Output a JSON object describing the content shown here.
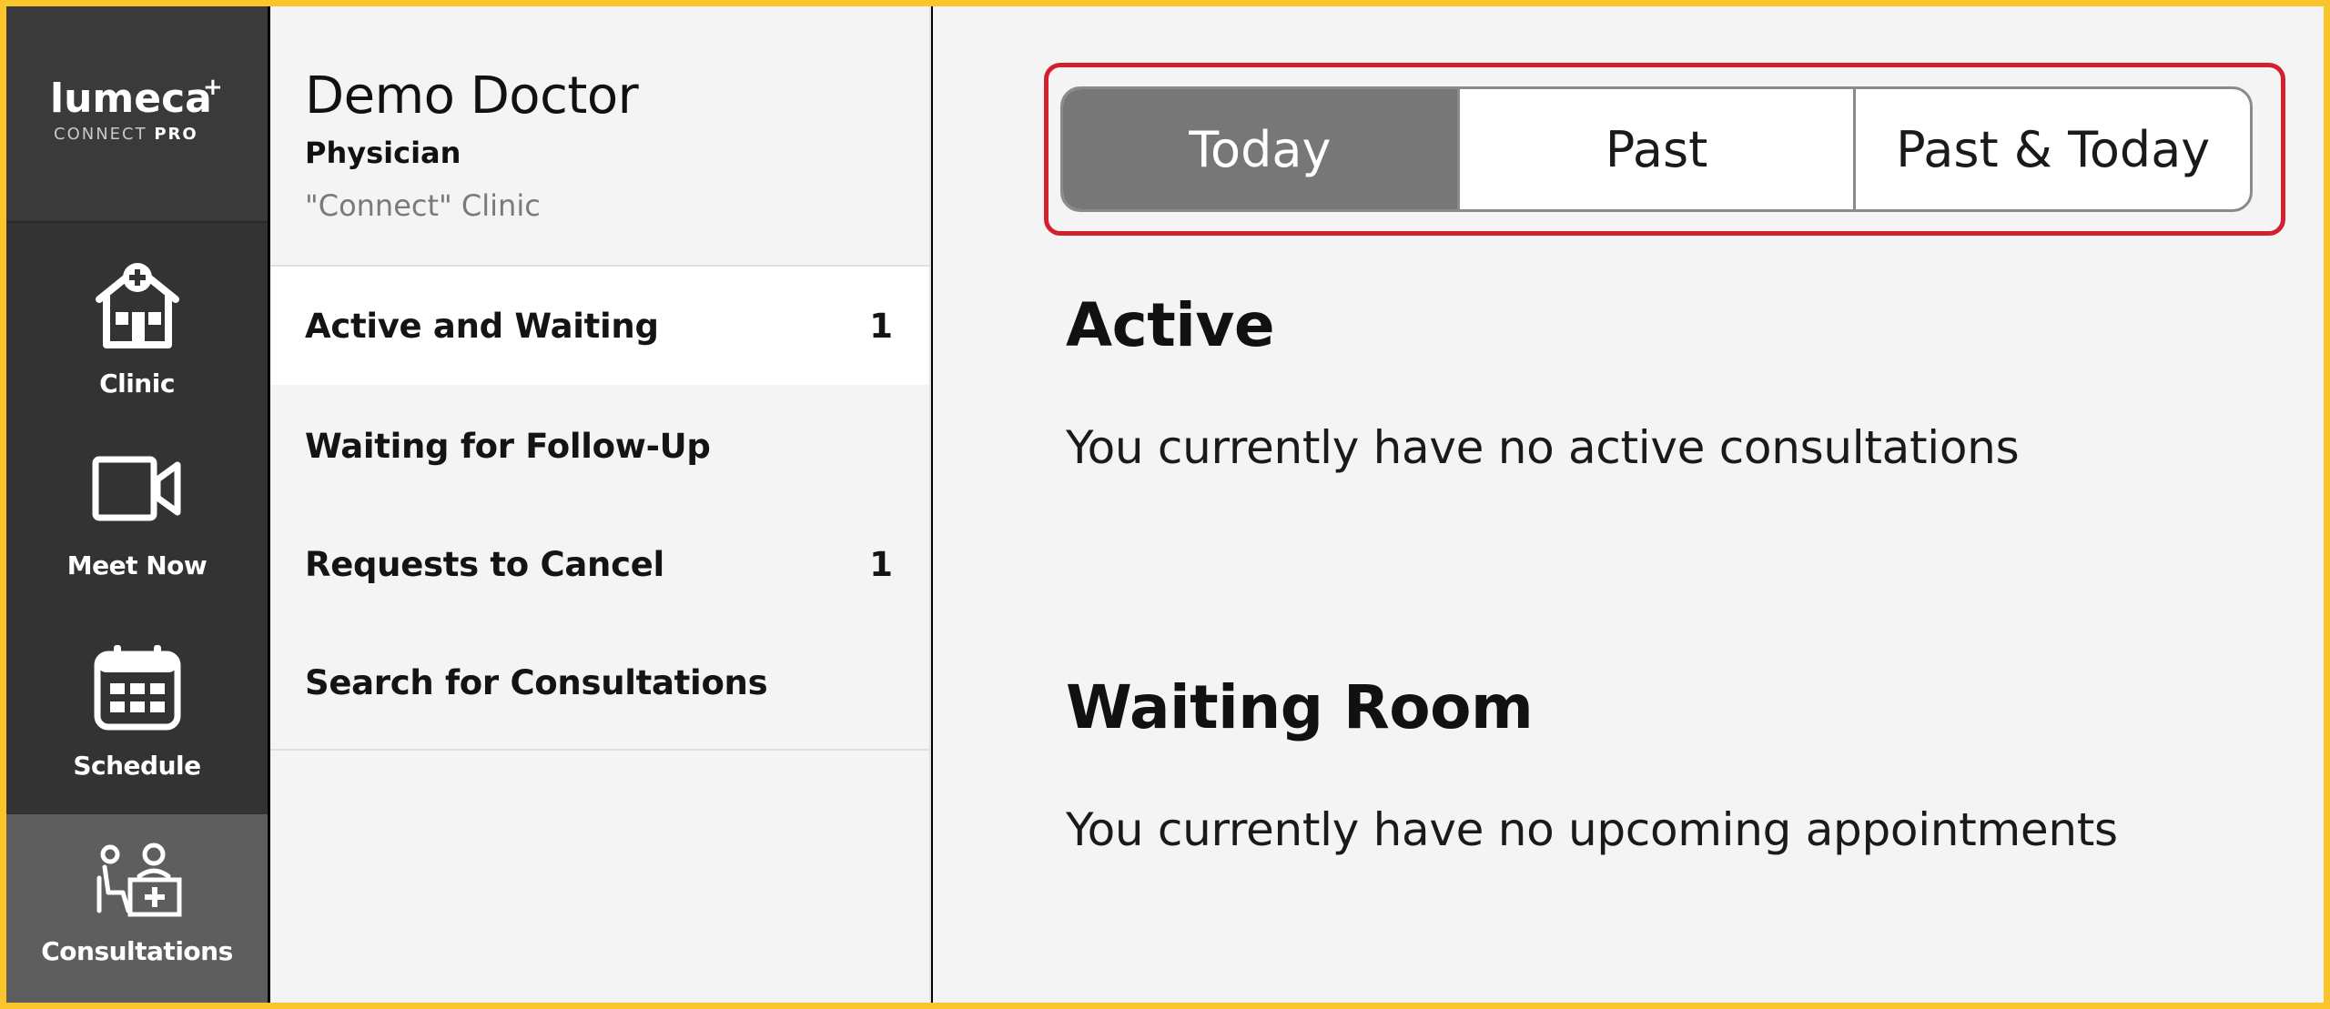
{
  "brand": {
    "name": "lumeca",
    "plus": "+",
    "subtitle_light": "CONNECT ",
    "subtitle_bold": "PRO"
  },
  "nav": {
    "items": [
      {
        "label": "Clinic",
        "icon": "clinic-icon",
        "active": false
      },
      {
        "label": "Meet Now",
        "icon": "video-camera-icon",
        "active": false
      },
      {
        "label": "Schedule",
        "icon": "calendar-icon",
        "active": false
      },
      {
        "label": "Consultations",
        "icon": "consultations-icon",
        "active": true
      }
    ]
  },
  "user": {
    "name": "Demo Doctor",
    "role": "Physician",
    "clinic": "\"Connect\" Clinic"
  },
  "menu": {
    "items": [
      {
        "label": "Active and Waiting",
        "count": "1",
        "selected": true
      },
      {
        "label": "Waiting for Follow-Up",
        "count": "",
        "selected": false
      },
      {
        "label": "Requests to Cancel",
        "count": "1",
        "selected": false
      },
      {
        "label": "Search for Consultations",
        "count": "",
        "selected": false
      }
    ]
  },
  "tabs": {
    "items": [
      {
        "label": "Today",
        "active": true
      },
      {
        "label": "Past",
        "active": false
      },
      {
        "label": "Past & Today",
        "active": false
      }
    ]
  },
  "sections": {
    "active": {
      "title": "Active",
      "message": "You currently have no active consultations"
    },
    "waiting_room": {
      "title": "Waiting Room",
      "message": "You currently have no upcoming appointments"
    }
  },
  "colors": {
    "frame_border": "#f9c52a",
    "nav_bg": "#333333",
    "nav_active_bg": "#5e5e5e",
    "tab_active_bg": "#777777",
    "highlight": "#d3202e"
  }
}
